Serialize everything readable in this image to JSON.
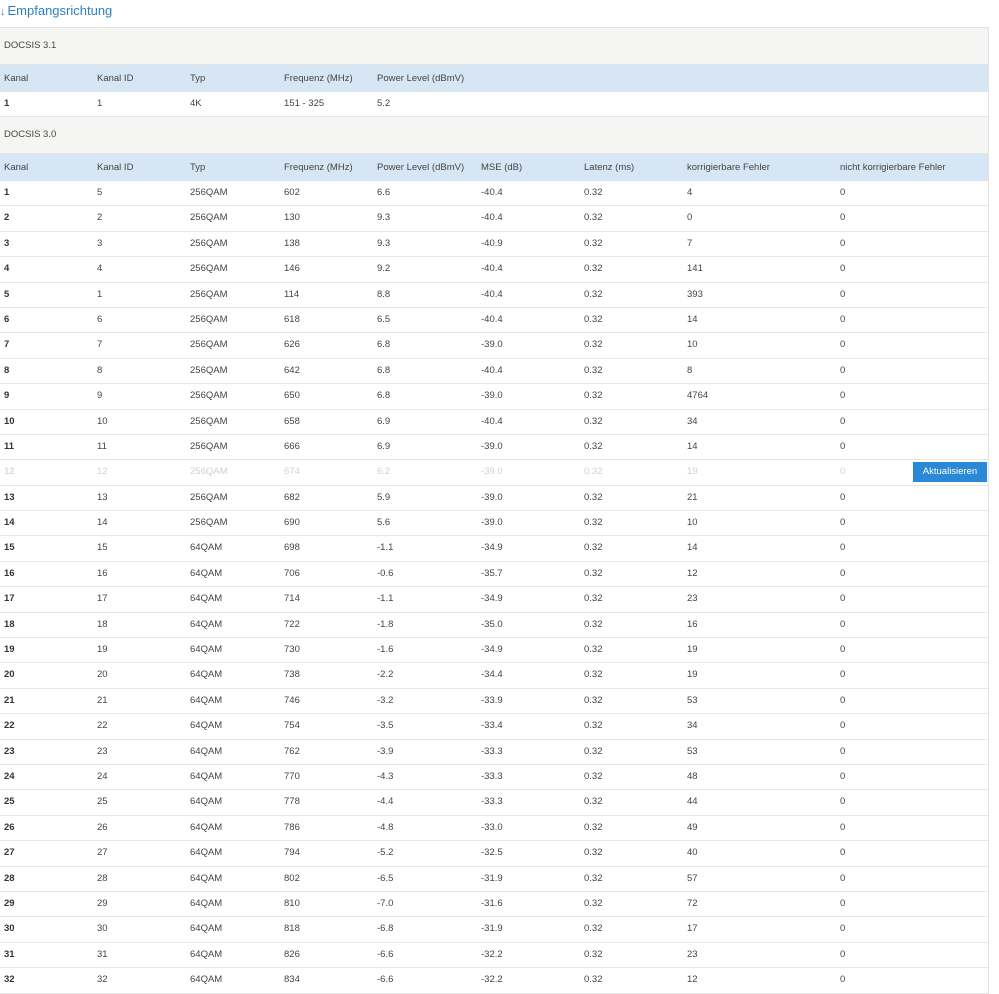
{
  "title": {
    "arrow": "↓",
    "text": "Empfangsrichtung"
  },
  "docsis31": {
    "label": "DOCSIS 3.1",
    "headers": [
      "Kanal",
      "Kanal ID",
      "Typ",
      "Frequenz (MHz)",
      "Power Level (dBmV)"
    ],
    "rows": [
      [
        "1",
        "1",
        "4K",
        "151 - 325",
        "5.2"
      ]
    ]
  },
  "docsis30": {
    "label": "DOCSIS 3.0",
    "headers": [
      "Kanal",
      "Kanal ID",
      "Typ",
      "Frequenz (MHz)",
      "Power Level (dBmV)",
      "MSE (dB)",
      "Latenz (ms)",
      "korrigierbare Fehler",
      "nicht korrigierbare Fehler"
    ],
    "rows": [
      [
        "1",
        "5",
        "256QAM",
        "602",
        "6.6",
        "-40.4",
        "0.32",
        "4",
        "0"
      ],
      [
        "2",
        "2",
        "256QAM",
        "130",
        "9.3",
        "-40.4",
        "0.32",
        "0",
        "0"
      ],
      [
        "3",
        "3",
        "256QAM",
        "138",
        "9.3",
        "-40.9",
        "0.32",
        "7",
        "0"
      ],
      [
        "4",
        "4",
        "256QAM",
        "146",
        "9.2",
        "-40.4",
        "0.32",
        "141",
        "0"
      ],
      [
        "5",
        "1",
        "256QAM",
        "114",
        "8.8",
        "-40.4",
        "0.32",
        "393",
        "0"
      ],
      [
        "6",
        "6",
        "256QAM",
        "618",
        "6.5",
        "-40.4",
        "0.32",
        "14",
        "0"
      ],
      [
        "7",
        "7",
        "256QAM",
        "626",
        "6.8",
        "-39.0",
        "0.32",
        "10",
        "0"
      ],
      [
        "8",
        "8",
        "256QAM",
        "642",
        "6.8",
        "-40.4",
        "0.32",
        "8",
        "0"
      ],
      [
        "9",
        "9",
        "256QAM",
        "650",
        "6.8",
        "-39.0",
        "0.32",
        "4764",
        "0"
      ],
      [
        "10",
        "10",
        "256QAM",
        "658",
        "6.9",
        "-40.4",
        "0.32",
        "34",
        "0"
      ],
      [
        "11",
        "11",
        "256QAM",
        "666",
        "6.9",
        "-39.0",
        "0.32",
        "14",
        "0"
      ],
      [
        "12",
        "12",
        "256QAM",
        "674",
        "6.2",
        "-39.0",
        "0.32",
        "19",
        "0"
      ],
      [
        "13",
        "13",
        "256QAM",
        "682",
        "5.9",
        "-39.0",
        "0.32",
        "21",
        "0"
      ],
      [
        "14",
        "14",
        "256QAM",
        "690",
        "5.6",
        "-39.0",
        "0.32",
        "10",
        "0"
      ],
      [
        "15",
        "15",
        "64QAM",
        "698",
        "-1.1",
        "-34.9",
        "0.32",
        "14",
        "0"
      ],
      [
        "16",
        "16",
        "64QAM",
        "706",
        "-0.6",
        "-35.7",
        "0.32",
        "12",
        "0"
      ],
      [
        "17",
        "17",
        "64QAM",
        "714",
        "-1.1",
        "-34.9",
        "0.32",
        "23",
        "0"
      ],
      [
        "18",
        "18",
        "64QAM",
        "722",
        "-1.8",
        "-35.0",
        "0.32",
        "16",
        "0"
      ],
      [
        "19",
        "19",
        "64QAM",
        "730",
        "-1.6",
        "-34.9",
        "0.32",
        "19",
        "0"
      ],
      [
        "20",
        "20",
        "64QAM",
        "738",
        "-2.2",
        "-34.4",
        "0.32",
        "19",
        "0"
      ],
      [
        "21",
        "21",
        "64QAM",
        "746",
        "-3.2",
        "-33.9",
        "0.32",
        "53",
        "0"
      ],
      [
        "22",
        "22",
        "64QAM",
        "754",
        "-3.5",
        "-33.4",
        "0.32",
        "34",
        "0"
      ],
      [
        "23",
        "23",
        "64QAM",
        "762",
        "-3.9",
        "-33.3",
        "0.32",
        "53",
        "0"
      ],
      [
        "24",
        "24",
        "64QAM",
        "770",
        "-4.3",
        "-33.3",
        "0.32",
        "48",
        "0"
      ],
      [
        "25",
        "25",
        "64QAM",
        "778",
        "-4.4",
        "-33.3",
        "0.32",
        "44",
        "0"
      ],
      [
        "26",
        "26",
        "64QAM",
        "786",
        "-4.8",
        "-33.0",
        "0.32",
        "49",
        "0"
      ],
      [
        "27",
        "27",
        "64QAM",
        "794",
        "-5.2",
        "-32.5",
        "0.32",
        "40",
        "0"
      ],
      [
        "28",
        "28",
        "64QAM",
        "802",
        "-6.5",
        "-31.9",
        "0.32",
        "57",
        "0"
      ],
      [
        "29",
        "29",
        "64QAM",
        "810",
        "-7.0",
        "-31.6",
        "0.32",
        "72",
        "0"
      ],
      [
        "30",
        "30",
        "64QAM",
        "818",
        "-6.8",
        "-31.9",
        "0.32",
        "17",
        "0"
      ],
      [
        "31",
        "31",
        "64QAM",
        "826",
        "-6.6",
        "-32.2",
        "0.32",
        "23",
        "0"
      ],
      [
        "32",
        "32",
        "64QAM",
        "834",
        "-6.6",
        "-32.2",
        "0.32",
        "12",
        "0"
      ]
    ],
    "faded_row": "12"
  },
  "refresh_button": {
    "label": "Aktualisieren",
    "color": "#2a88d6"
  }
}
